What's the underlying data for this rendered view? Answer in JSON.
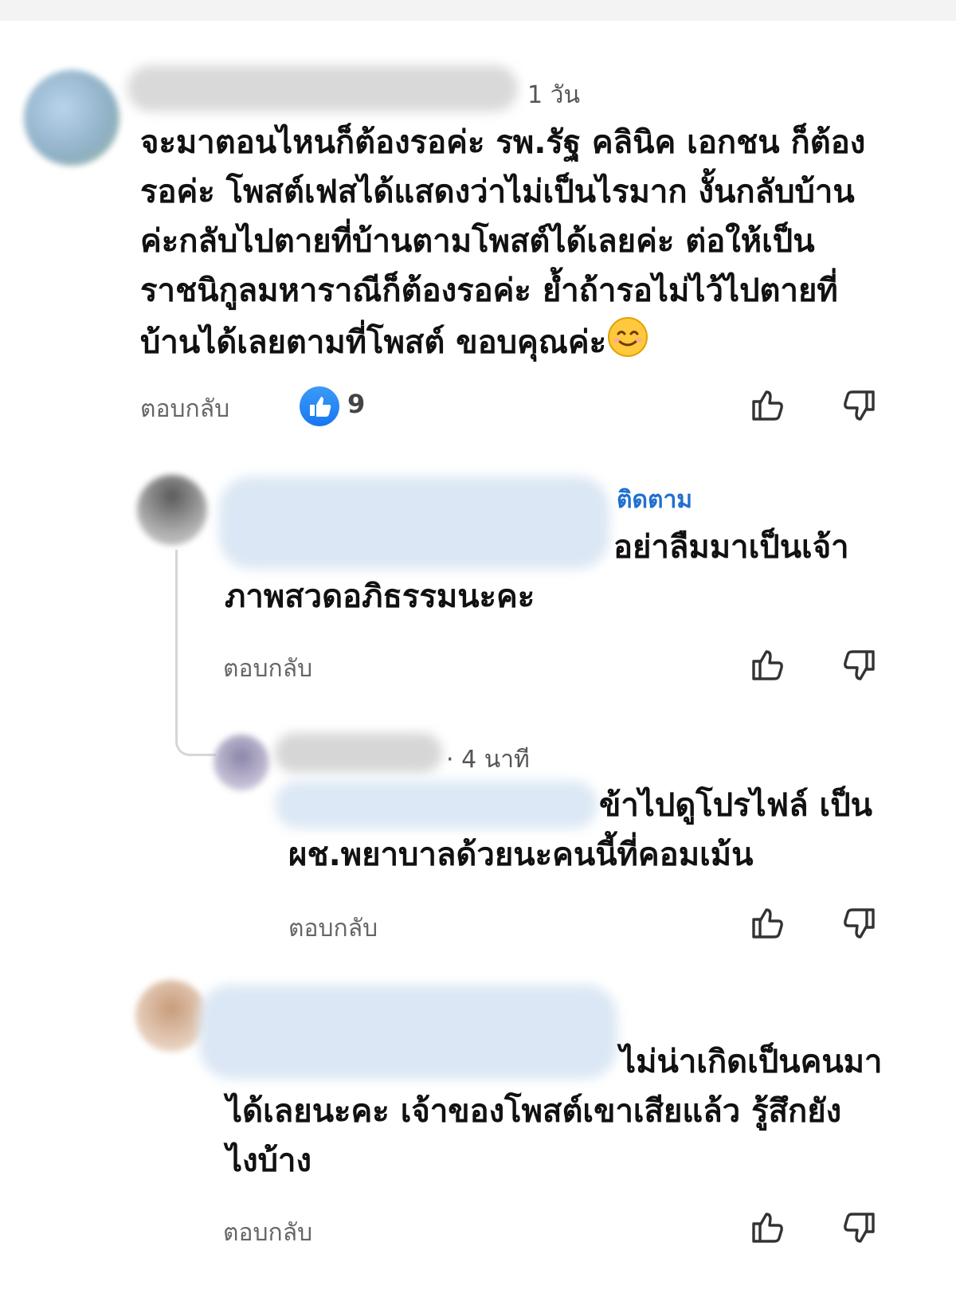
{
  "comments": [
    {
      "time": "1 วัน",
      "text": "จะมาตอนไหนก็ต้องรอค่ะ รพ.รัฐ คลินิค เอกชน ก็ต้อง\nรอค่ะ โพสต์เฟสได้แสดงว่าไม่เป็นไรมาก งั้นกลับบ้าน\nค่ะกลับไปตายที่บ้านตามโพสต์ได้เลยค่ะ ต่อให้เป็น\nราชนิกูลมหาราณีก็ต้องรอค่ะ ย้ำถ้ารอไม่ไว้ไปตายที่\nบ้านได้เลยตามที่โพสต์ ขอบคุณค่ะ",
      "reply_label": "ตอบกลับ",
      "like_count": "9"
    },
    {
      "follow_label": "ติดตาม",
      "text": "อย่าลืมมาเป็นเจ้า\nภาพสวดอภิธรรมนะคะ",
      "reply_label": "ตอบกลับ"
    },
    {
      "time": "· 4 นาที",
      "text": "ข้าไปดูโปรไฟล์ เป็น\nผช.พยาบาลด้วยนะคนนี้ที่คอมเม้น",
      "reply_label": "ตอบกลับ"
    },
    {
      "text": "ไม่น่าเกิดเป็นคนมา\nได้เลยนะคะ เจ้าของโพสต์เขาเสียแล้ว รู้สึกยัง\nไงบ้าง",
      "reply_label": "ตอบกลับ"
    }
  ],
  "icons": {
    "like": "thumbs-up-outline-icon",
    "dislike": "thumbs-down-outline-icon",
    "like_badge": "facebook-like-badge-icon",
    "emoji": "smiling-face-emoji"
  },
  "colors": {
    "accent": "#1f6fcf",
    "like_badge": "#1877f2"
  }
}
